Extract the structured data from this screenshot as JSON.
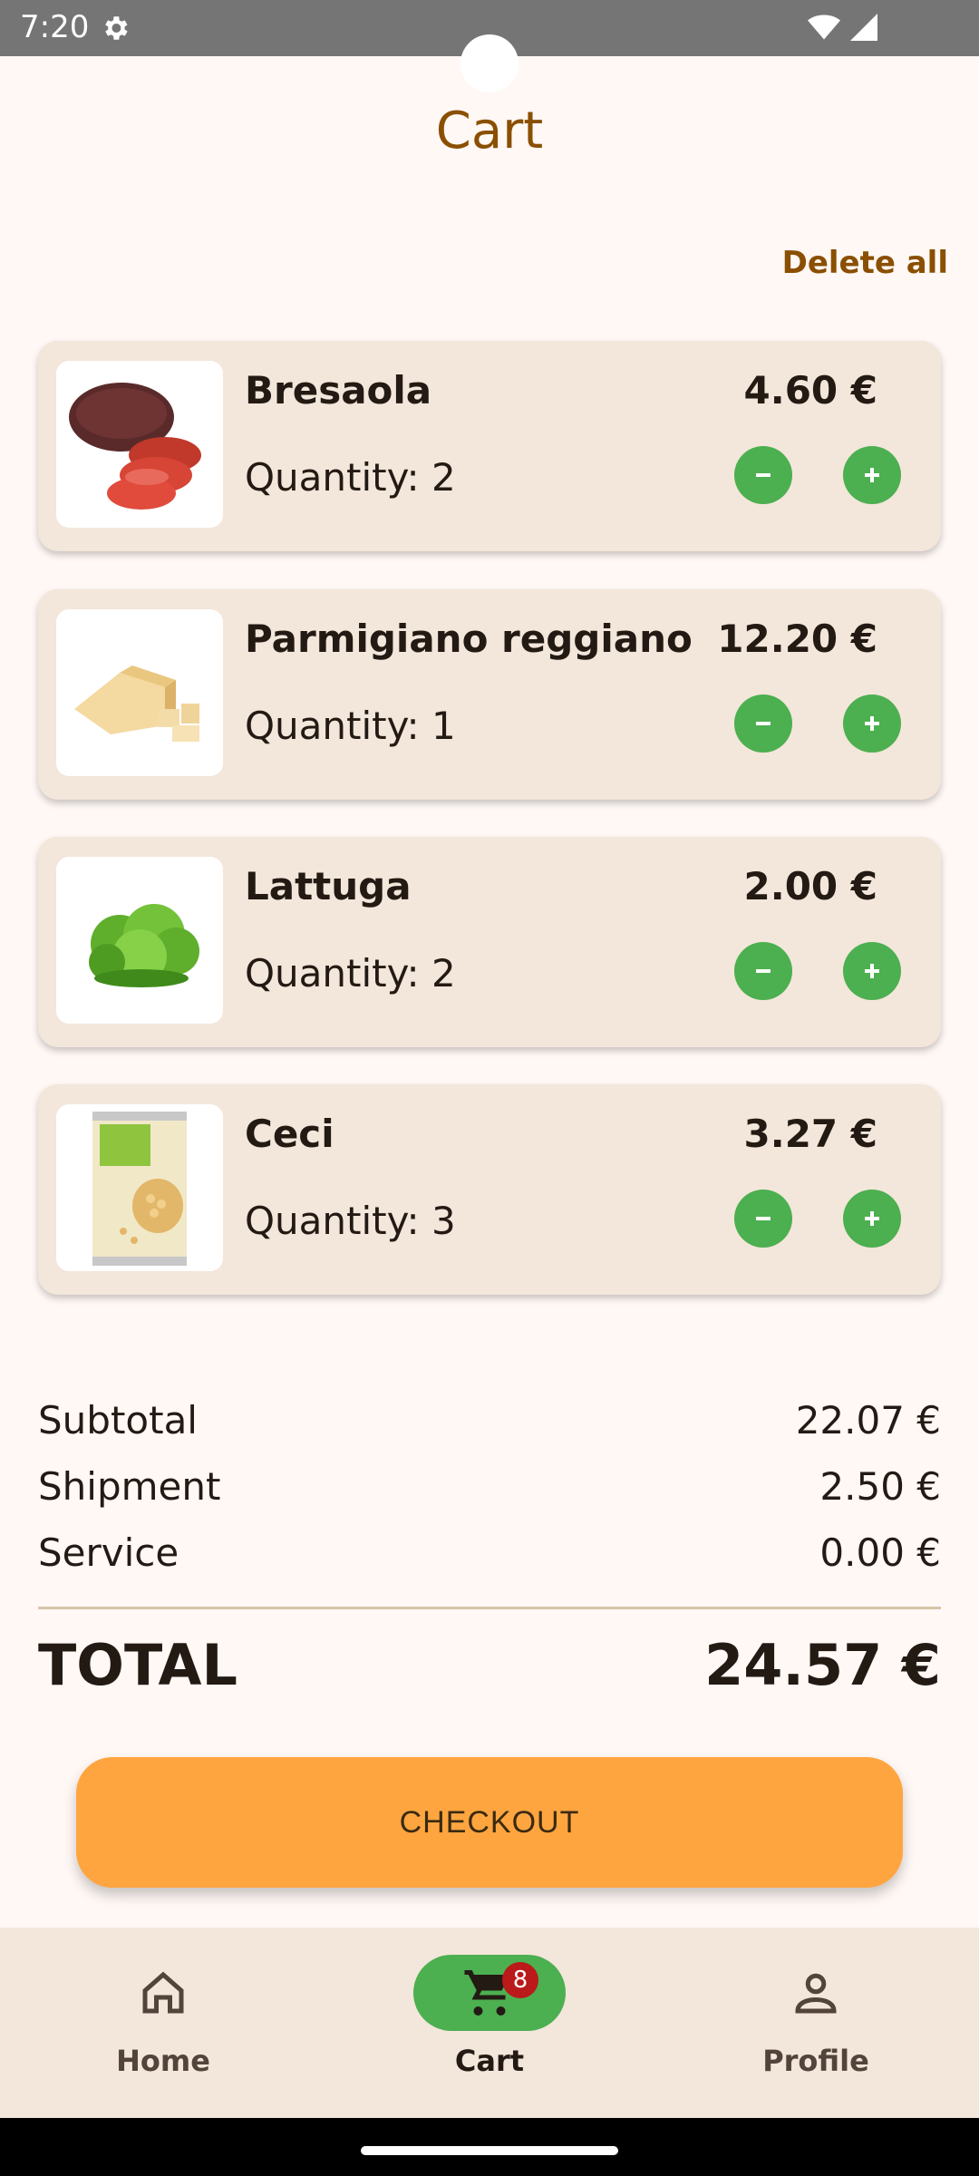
{
  "status_bar": {
    "time": "7:20"
  },
  "header": {
    "title": "Cart",
    "delete_all": "Delete all"
  },
  "cart": {
    "items": [
      {
        "name": "Bresaola",
        "quantity_label": "Quantity: 2",
        "price": "4.60 €",
        "image": "bresaola-image"
      },
      {
        "name": "Parmigiano reggiano",
        "quantity_label": "Quantity: 1",
        "price": "12.20 €",
        "image": "parmesan-image"
      },
      {
        "name": "Lattuga",
        "quantity_label": "Quantity: 2",
        "price": "2.00 €",
        "image": "lettuce-image"
      },
      {
        "name": "Ceci",
        "quantity_label": "Quantity: 3",
        "price": "3.27 €",
        "image": "chickpea-can-image"
      }
    ],
    "buttons": {
      "decrease_icon": "minus-icon",
      "increase_icon": "plus-icon"
    }
  },
  "summary": {
    "subtotal_label": "Subtotal",
    "subtotal_value": "22.07 €",
    "shipment_label": "Shipment",
    "shipment_value": "2.50 €",
    "service_label": "Service",
    "service_value": "0.00 €",
    "total_label": "TOTAL",
    "total_value": "24.57 €"
  },
  "checkout": {
    "label": "CHECKOUT"
  },
  "bottom_nav": {
    "items": [
      {
        "label": "Home",
        "icon": "home-icon",
        "active": false
      },
      {
        "label": "Cart",
        "icon": "cart-icon",
        "active": true,
        "badge": "8"
      },
      {
        "label": "Profile",
        "icon": "person-icon",
        "active": false
      }
    ]
  },
  "colors": {
    "background": "#fff8f5",
    "card": "#f3e6da",
    "accent_brown": "#8a4f00",
    "green": "#4caf50",
    "checkout_orange": "#ffa540",
    "badge_red": "#ba1a1a"
  }
}
